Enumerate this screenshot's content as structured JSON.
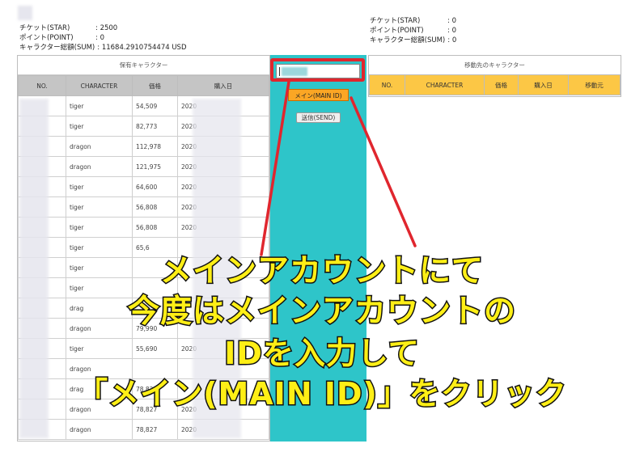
{
  "left_stats": {
    "star_label": "チケット(STAR)",
    "star_value": ": 2500",
    "point_label": "ポイント(POINT)",
    "point_value": ": 0",
    "sum_label": "キャラクター総額(SUM)",
    "sum_value": ": 11684.2910754474 USD"
  },
  "right_stats": {
    "star_label": "チケット(STAR)",
    "star_value": ": 0",
    "point_label": "ポイント(POINT)",
    "point_value": ": 0",
    "sum_label": "キャラクター総額(SUM)",
    "sum_value": ": 0"
  },
  "owned_panel": {
    "title": "保有キャラクター",
    "columns": [
      "NO.",
      "CHARACTER",
      "価格",
      "購入日"
    ],
    "rows": [
      {
        "character": "tiger",
        "price": "54,509",
        "date": "2020"
      },
      {
        "character": "tiger",
        "price": "82,773",
        "date": "2020"
      },
      {
        "character": "dragon",
        "price": "112,978",
        "date": "2020"
      },
      {
        "character": "dragon",
        "price": "121,975",
        "date": "2020"
      },
      {
        "character": "tiger",
        "price": "64,600",
        "date": "2020"
      },
      {
        "character": "tiger",
        "price": "56,808",
        "date": "2020"
      },
      {
        "character": "tiger",
        "price": "56,808",
        "date": "2020"
      },
      {
        "character": "tiger",
        "price": "65,6",
        "date": ""
      },
      {
        "character": "tiger",
        "price": "",
        "date": ""
      },
      {
        "character": "tiger",
        "price": "",
        "date": ""
      },
      {
        "character": "drag",
        "price": "",
        "date": ""
      },
      {
        "character": "dragon",
        "price": "79,990",
        "date": ""
      },
      {
        "character": "tiger",
        "price": "55,690",
        "date": "2020"
      },
      {
        "character": "dragon",
        "price": "",
        "date": ""
      },
      {
        "character": "drag",
        "price": "78,827",
        "date": ""
      },
      {
        "character": "dragon",
        "price": "78,827",
        "date": "2020"
      },
      {
        "character": "dragon",
        "price": "78,827",
        "date": "2020"
      }
    ]
  },
  "transfer_panel": {
    "title": "移動先のキャラクター",
    "columns": [
      "NO.",
      "CHARACTER",
      "価格",
      "購入日",
      "移動元"
    ]
  },
  "actions": {
    "main_id_label": "メイン(MAIN ID)",
    "send_label": "送信(SEND)"
  },
  "caption": {
    "line1": "メインアカウントにて",
    "line2": "今度はメインアカウントの",
    "line3": "IDを入力して",
    "line4": "「メイン(MAIN ID)」をクリック"
  },
  "colors": {
    "teal": "#2ec5c9",
    "highlight_red": "#e0262e",
    "button_orange": "#fba624",
    "caption_yellow": "#ffef16",
    "header_gold": "#fcc745"
  }
}
